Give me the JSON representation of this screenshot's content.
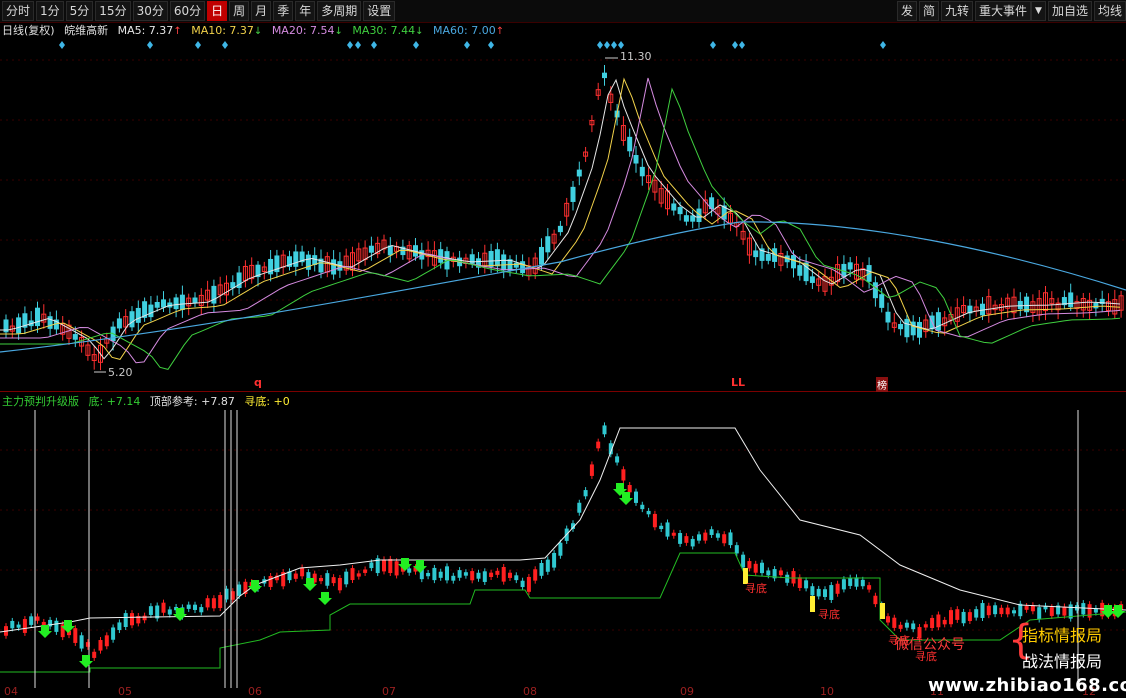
{
  "toolbar": {
    "left": [
      "分时",
      "1分",
      "5分",
      "15分",
      "30分",
      "60分",
      "日",
      "周",
      "月",
      "季",
      "年",
      "多周期",
      "设置"
    ],
    "active_index": 6,
    "right": [
      "发",
      "简",
      "九转",
      "重大事件",
      "加自选",
      "均线"
    ],
    "dropdown_arrow": "▼"
  },
  "ma_header": {
    "period_label": "日线(复权)",
    "stock_name": "皖维高新",
    "ma5": "MA5: 7.37",
    "ma5_dir": "↑",
    "ma10": "MA10: 7.37",
    "ma10_dir": "↓",
    "ma20": "MA20: 7.54",
    "ma20_dir": "↓",
    "ma30": "MA30: 7.44",
    "ma30_dir": "↓",
    "ma60": "MA60: 7.00",
    "ma60_dir": "↑"
  },
  "price_labels": {
    "high": "11.30",
    "low": "5.20"
  },
  "marks": {
    "q": "q",
    "ll": "LL",
    "bang": "榜"
  },
  "indicator_header": {
    "name": "主力预判升级版",
    "bottom": "底: +7.14",
    "top": "顶部参考: +7.87",
    "seek": "寻底: +0"
  },
  "signal_labels": [
    "寻底",
    "寻底",
    "寻底",
    "寻底"
  ],
  "x_axis": [
    "04",
    "05",
    "06",
    "07",
    "08",
    "09",
    "10",
    "11",
    "12"
  ],
  "watermark": {
    "brace_text": "微信公众号",
    "line1": "指标情报局",
    "line2": "战法情报局",
    "url": "www.zhibiao168.com"
  },
  "colors": {
    "bg": "#000000",
    "up": "#ff3030",
    "down": "#40d0e0",
    "ma5": "#e6e6e6",
    "ma10": "#f2d24a",
    "ma20": "#d58be0",
    "ma30": "#3fcf3f",
    "ma60": "#4aa8e0",
    "signal_green": "#22ee22",
    "signal_yellow": "#ffee33"
  }
}
